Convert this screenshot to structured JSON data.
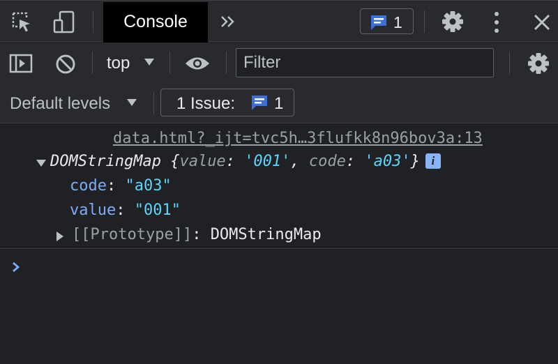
{
  "toolbar": {
    "tab_label": "Console",
    "issue_count": "1"
  },
  "filter_bar": {
    "context": "top",
    "filter_placeholder": "Filter"
  },
  "levels_bar": {
    "levels_label": "Default levels",
    "issues_label": "1 Issue:",
    "issues_count": "1"
  },
  "console": {
    "source_link": "data.html?_ijt=tvc5h…3flufkk8n96bov3a:13",
    "object_type": "DOMStringMap",
    "preview": {
      "open": "{",
      "k1": "value",
      "v1": "'001'",
      "k2": "code",
      "v2": "'a03'",
      "close": "}"
    },
    "props": [
      {
        "key": "code",
        "value": "\"a03\""
      },
      {
        "key": "value",
        "value": "\"001\""
      }
    ],
    "prototype_label": "[[Prototype]]",
    "prototype_value": "DOMStringMap",
    "info_glyph": "i"
  },
  "icons": [
    "inspect-element-icon",
    "device-toolbar-icon",
    "more-tabs-icon",
    "message-icon",
    "settings-icon",
    "kebab-menu-icon",
    "close-icon",
    "sidebar-toggle-icon",
    "clear-console-icon",
    "dropdown-arrow-icon",
    "eye-icon",
    "expand-triangle-icon",
    "prompt-chevron-icon"
  ],
  "colors": {
    "background": "#202124",
    "toolbar": "#292a2d",
    "accent": "#3d6fd9",
    "key": "#7cacf8",
    "string": "#5cd5fb"
  }
}
